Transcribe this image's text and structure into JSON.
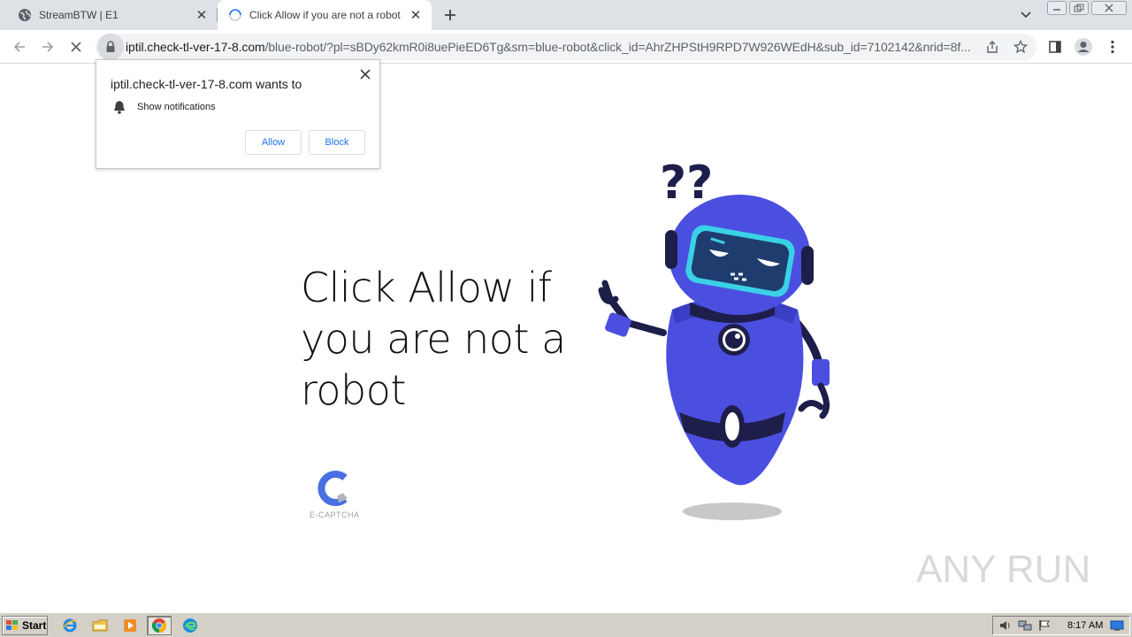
{
  "browser": {
    "tabs": [
      {
        "title": "StreamBTW | E1",
        "active": false,
        "favicon": "globe-icon"
      },
      {
        "title": "Click Allow if you are not a robot",
        "active": true,
        "favicon": "loading-spinner-icon"
      }
    ],
    "url": {
      "host": "iptil.check-tl-ver-17-8.com",
      "path": "/blue-robot/?pl=sBDy62kmR0i8uePieED6Tg&sm=blue-robot&click_id=AhrZHPStH9RPD7W926WEdH&sub_id=7102142&nrid=8f..."
    }
  },
  "permission_prompt": {
    "title": "iptil.check-tl-ver-17-8.com wants to",
    "permission": "Show notifications",
    "allow_label": "Allow",
    "block_label": "Block"
  },
  "page": {
    "headline": "Click Allow if you are not a robot",
    "captcha_label": "E-CAPTCHA"
  },
  "watermark": "ANY RUN",
  "taskbar": {
    "start_label": "Start",
    "clock": "8:17 AM"
  },
  "colors": {
    "robot_blue": "#4b4fe0",
    "robot_dark": "#1e1e4a",
    "visor_cyan": "#3ad0e6",
    "link_blue": "#1a73e8"
  }
}
